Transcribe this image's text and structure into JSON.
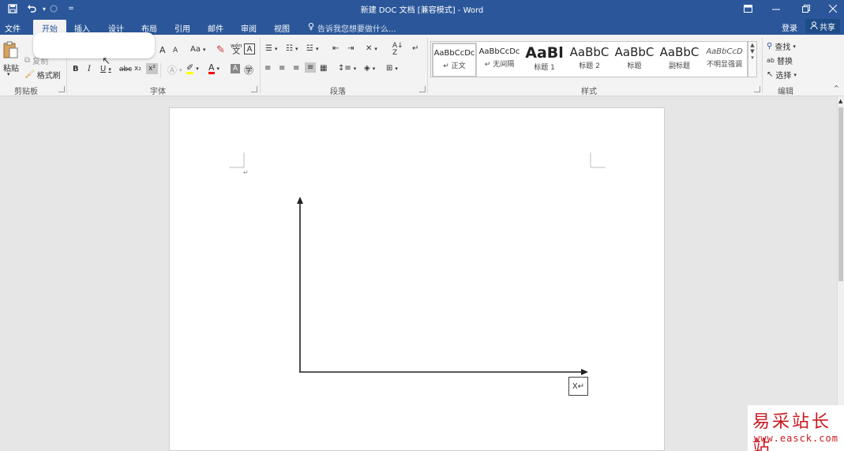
{
  "window": {
    "title": "新建 DOC 文档 [兼容模式] - Word"
  },
  "quick_access": {
    "save_icon": "save-icon",
    "undo_icon": "undo-icon",
    "redo_icon": "redo-icon",
    "customize_icon": "customize-qat-icon"
  },
  "tabs": [
    {
      "label": "文件"
    },
    {
      "label": "开始"
    },
    {
      "label": "插入"
    },
    {
      "label": "设计"
    },
    {
      "label": "布局"
    },
    {
      "label": "引用"
    },
    {
      "label": "邮件"
    },
    {
      "label": "审阅"
    },
    {
      "label": "视图"
    }
  ],
  "tell_me": "告诉我您想要做什么...",
  "account": {
    "login": "登录",
    "share": "共享"
  },
  "clipboard": {
    "paste": "粘贴",
    "copy": "复制",
    "format_painter": "格式刷",
    "label": "剪贴板"
  },
  "font": {
    "case": "Aa",
    "label": "字体",
    "bold": "B",
    "italic": "I",
    "underline": "U",
    "strike": "abc",
    "subscript": "x₂",
    "superscript": "x²",
    "phonetic": "wén\n文",
    "char_border": "A",
    "grow": "A",
    "shrink": "A"
  },
  "paragraph": {
    "label": "段落"
  },
  "styles": {
    "label": "样式",
    "items": [
      {
        "sample": "AaBbCcDc",
        "name": "↵ 正文"
      },
      {
        "sample": "AaBbCcDc",
        "name": "↵ 无间隔"
      },
      {
        "sample": "AaBl",
        "name": "标题 1"
      },
      {
        "sample": "AaBbC",
        "name": "标题 2"
      },
      {
        "sample": "AaBbC",
        "name": "标题"
      },
      {
        "sample": "AaBbC",
        "name": "副标题"
      },
      {
        "sample": "AaBbCcD",
        "name": "不明显强调"
      }
    ]
  },
  "editing": {
    "label": "编辑",
    "find": "查找",
    "replace": "替换",
    "select": "选择"
  },
  "document": {
    "x_axis_label": "X↵",
    "para_mark": "↵"
  },
  "watermark": {
    "cn": "易采站长站",
    "url": "www.easck.com"
  },
  "colors": {
    "brand": "#2b579a",
    "highlight": "#ffff00",
    "font_color": "#ff0000",
    "watermark": "#c9181f"
  }
}
